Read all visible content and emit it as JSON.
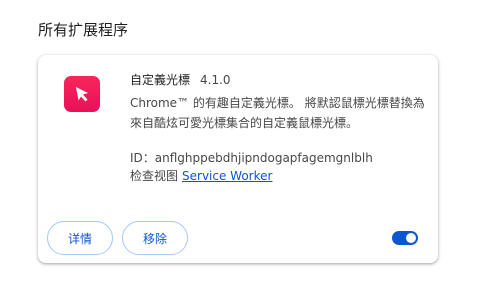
{
  "section": {
    "title": "所有扩展程序"
  },
  "extension": {
    "icon": "cursor-icon",
    "icon_color": "#f0185a",
    "name": "自定義光標",
    "version": "4.1.0",
    "description": "Chrome™ 的有趣自定義光標。 將默認鼠標光標替換為來自酷炫可愛光標集合的自定義鼠標光標。",
    "id_label": "ID：",
    "id_value": "anflghppebdhjipndogapfagemgnlblh",
    "inspect_label": "检查视图",
    "inspect_link": "Service Worker",
    "enabled": true
  },
  "buttons": {
    "details": "详情",
    "remove": "移除"
  },
  "colors": {
    "accent": "#0b57d0",
    "button_border": "#a8c7fa"
  }
}
